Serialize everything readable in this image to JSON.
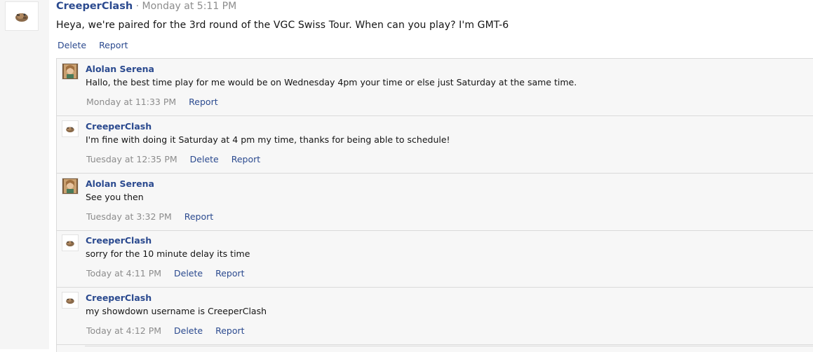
{
  "post": {
    "author": "CreeperClash",
    "separator": "·",
    "time": "Monday at 5:11 PM",
    "text": "Heya, we're paired for the 3rd round of the VGC Swiss Tour. When can you play? I'm GMT-6",
    "actions": {
      "delete": "Delete",
      "report": "Report"
    }
  },
  "replies": [
    {
      "author": "Alolan Serena",
      "avatar": "serena-avatar",
      "text": "Hallo, the best time play for me would be on Wednesday 4pm your time or else just Saturday at the same time.",
      "time": "Monday at 11:33 PM",
      "delete": "",
      "report": "Report"
    },
    {
      "author": "CreeperClash",
      "avatar": "creeper-avatar",
      "text": "I'm fine with doing it Saturday at 4 pm my time, thanks for being able to schedule!",
      "time": "Tuesday at 12:35 PM",
      "delete": "Delete",
      "report": "Report"
    },
    {
      "author": "Alolan Serena",
      "avatar": "serena-avatar",
      "text": "See you then",
      "time": "Tuesday at 3:32 PM",
      "delete": "",
      "report": "Report"
    },
    {
      "author": "CreeperClash",
      "avatar": "creeper-avatar",
      "text": "sorry for the 10 minute delay its time",
      "time": "Today at 4:11 PM",
      "delete": "Delete",
      "report": "Report"
    },
    {
      "author": "CreeperClash",
      "avatar": "creeper-avatar",
      "text": "my showdown username is CreeperClash",
      "time": "Today at 4:12 PM",
      "delete": "Delete",
      "report": "Report"
    }
  ],
  "colors": {
    "link": "#2b4a8f",
    "muted": "#8c8c8c",
    "reply_bg": "#f7f7f7",
    "border": "#dadada"
  }
}
